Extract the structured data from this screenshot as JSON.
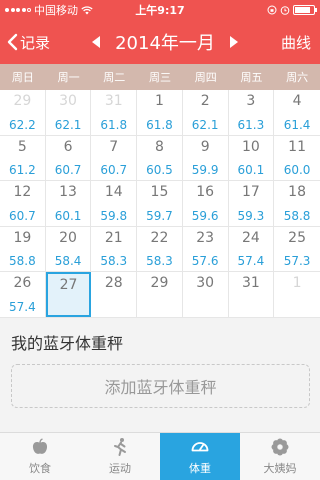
{
  "status_bar": {
    "carrier": "中国移动",
    "time": "上午9:17",
    "battery_level": 0.85,
    "icons": [
      "signal-icon",
      "wifi-icon",
      "lock-rotation-icon",
      "alarm-icon",
      "battery-icon"
    ]
  },
  "nav": {
    "back_label": "记录",
    "month_title": "2014年一月",
    "right_label": "曲线"
  },
  "colors": {
    "nav_bg": "#ef5350",
    "weekday_bg": "#d3b8ad",
    "weight_text": "#2a9fd8",
    "active_tab": "#29a4e0"
  },
  "calendar": {
    "weekdays": [
      "周日",
      "周一",
      "周二",
      "周三",
      "周四",
      "周五",
      "周六"
    ],
    "rows": [
      [
        {
          "day": "29",
          "weight": "62.2",
          "muted": true
        },
        {
          "day": "30",
          "weight": "62.1",
          "muted": true
        },
        {
          "day": "31",
          "weight": "61.8",
          "muted": true
        },
        {
          "day": "1",
          "weight": "61.8"
        },
        {
          "day": "2",
          "weight": "62.1"
        },
        {
          "day": "3",
          "weight": "61.3"
        },
        {
          "day": "4",
          "weight": "61.4"
        }
      ],
      [
        {
          "day": "5",
          "weight": "61.2"
        },
        {
          "day": "6",
          "weight": "60.7"
        },
        {
          "day": "7",
          "weight": "60.7"
        },
        {
          "day": "8",
          "weight": "60.5"
        },
        {
          "day": "9",
          "weight": "59.9"
        },
        {
          "day": "10",
          "weight": "60.1"
        },
        {
          "day": "11",
          "weight": "60.0"
        }
      ],
      [
        {
          "day": "12",
          "weight": "60.7"
        },
        {
          "day": "13",
          "weight": "60.1"
        },
        {
          "day": "14",
          "weight": "59.8"
        },
        {
          "day": "15",
          "weight": "59.7"
        },
        {
          "day": "16",
          "weight": "59.6"
        },
        {
          "day": "17",
          "weight": "59.3"
        },
        {
          "day": "18",
          "weight": "58.8"
        }
      ],
      [
        {
          "day": "19",
          "weight": "58.8"
        },
        {
          "day": "20",
          "weight": "58.4"
        },
        {
          "day": "21",
          "weight": "58.3"
        },
        {
          "day": "22",
          "weight": "58.3"
        },
        {
          "day": "23",
          "weight": "57.6"
        },
        {
          "day": "24",
          "weight": "57.4"
        },
        {
          "day": "25",
          "weight": "57.3"
        }
      ],
      [
        {
          "day": "26",
          "weight": "57.4"
        },
        {
          "day": "27",
          "weight": "",
          "today": true
        },
        {
          "day": "28",
          "weight": ""
        },
        {
          "day": "29",
          "weight": ""
        },
        {
          "day": "30",
          "weight": ""
        },
        {
          "day": "31",
          "weight": ""
        },
        {
          "day": "1",
          "weight": "",
          "muted": true
        }
      ]
    ]
  },
  "scale": {
    "title": "我的蓝牙体重秤",
    "add_button_label": "添加蓝牙体重秤"
  },
  "tabs": [
    {
      "label": "饮食",
      "icon": "apple-icon",
      "name": "tab-diet",
      "active": false
    },
    {
      "label": "运动",
      "icon": "running-icon",
      "name": "tab-exercise",
      "active": false
    },
    {
      "label": "体重",
      "icon": "scale-gauge-icon",
      "name": "tab-weight",
      "active": true
    },
    {
      "label": "大姨妈",
      "icon": "flower-icon",
      "name": "tab-period",
      "active": false
    }
  ]
}
